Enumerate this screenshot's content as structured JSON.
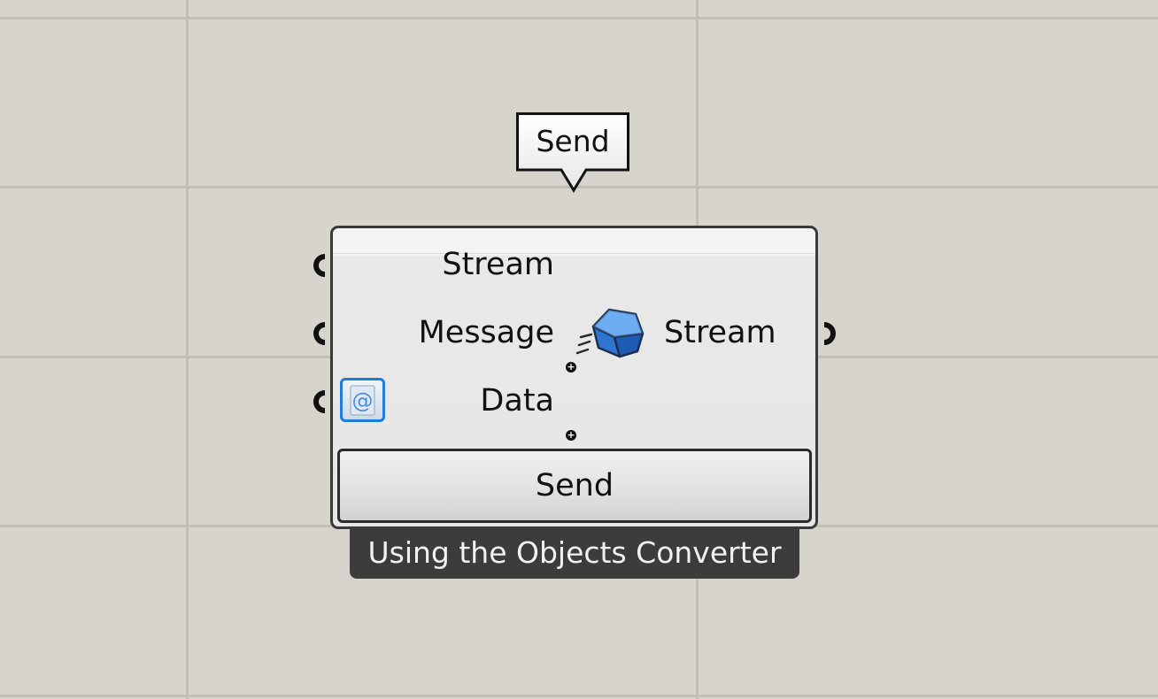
{
  "canvas": {
    "background_color": "#d7d4cd",
    "grid_color": "#c2bfb8"
  },
  "tooltip": {
    "text": "Send"
  },
  "component": {
    "inputs": [
      {
        "label": "Stream"
      },
      {
        "label": "Message"
      },
      {
        "label": "Data"
      }
    ],
    "outputs": [
      {
        "label": "Stream"
      }
    ],
    "icon": "stream-cube-icon",
    "data_badge_icon": "at-sign-icon",
    "data_badge_color": "#1e7be0",
    "button_label": "Send",
    "caption": "Using the Objects Converter"
  }
}
